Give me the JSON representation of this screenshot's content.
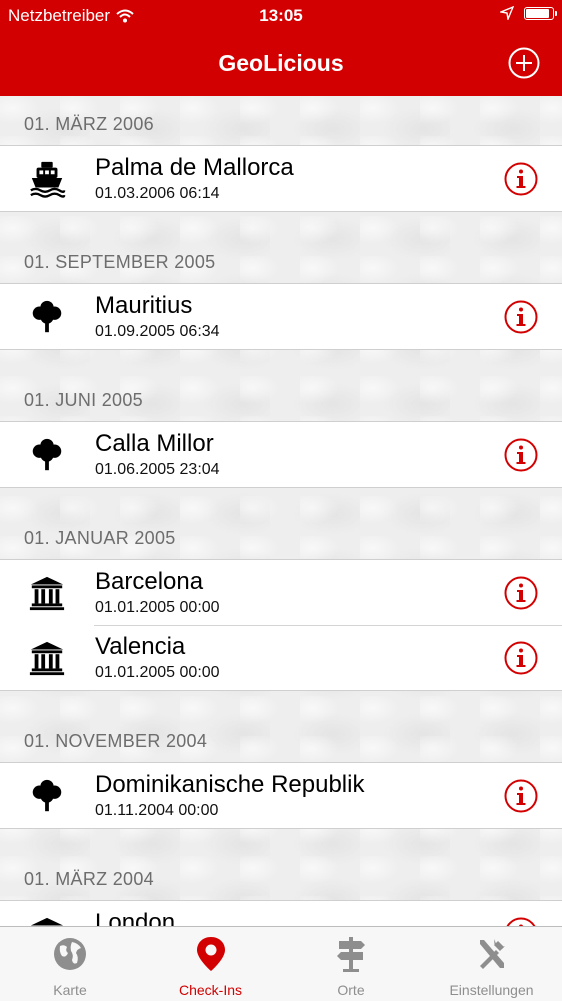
{
  "status_bar": {
    "carrier": "Netzbetreiber",
    "time": "13:05",
    "battery_level": 0.95
  },
  "nav": {
    "title": "GeoLicious",
    "add_icon": "plus-circle-icon"
  },
  "colors": {
    "brand_red": "#d20000",
    "tab_inactive": "#8e8e8e",
    "section_text": "#6d6d6d"
  },
  "sections": [
    {
      "header": "01. MÄRZ 2006",
      "rows": [
        {
          "icon": "ship-icon",
          "name": "Palma de Mallorca",
          "date": "01.03.2006 06:14"
        }
      ]
    },
    {
      "header": "01. SEPTEMBER 2005",
      "rows": [
        {
          "icon": "tree-icon",
          "name": "Mauritius",
          "date": "01.09.2005 06:34"
        }
      ]
    },
    {
      "header": "01. JUNI 2005",
      "rows": [
        {
          "icon": "tree-icon",
          "name": "Calla Millor",
          "date": "01.06.2005 23:04"
        }
      ]
    },
    {
      "header": "01. JANUAR 2005",
      "rows": [
        {
          "icon": "museum-icon",
          "name": "Barcelona",
          "date": "01.01.2005 00:00"
        },
        {
          "icon": "museum-icon",
          "name": "Valencia",
          "date": "01.01.2005 00:00"
        }
      ]
    },
    {
      "header": "01. NOVEMBER 2004",
      "rows": [
        {
          "icon": "tree-icon",
          "name": "Dominikanische Republik",
          "date": "01.11.2004 00:00"
        }
      ]
    },
    {
      "header": "01. MÄRZ 2004",
      "rows": [
        {
          "icon": "museum-icon",
          "name": "London",
          "date": ""
        }
      ]
    }
  ],
  "tabs": [
    {
      "label": "Karte",
      "icon": "globe-icon",
      "active": false
    },
    {
      "label": "Check-Ins",
      "icon": "map-pin-icon",
      "active": true
    },
    {
      "label": "Orte",
      "icon": "signpost-icon",
      "active": false
    },
    {
      "label": "Einstellungen",
      "icon": "tools-icon",
      "active": false
    }
  ]
}
